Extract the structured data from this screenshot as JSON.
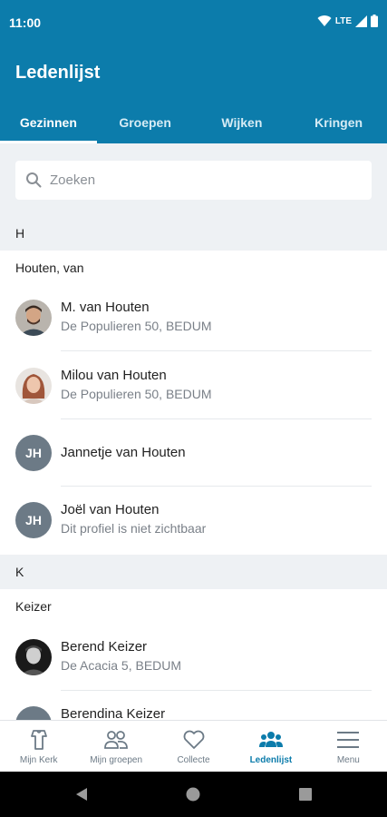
{
  "status_bar": {
    "time": "11:00",
    "network": "LTE"
  },
  "app_bar": {
    "title": "Ledenlijst"
  },
  "tabs": [
    {
      "label": "Gezinnen",
      "active": true
    },
    {
      "label": "Groepen",
      "active": false
    },
    {
      "label": "Wijken",
      "active": false
    },
    {
      "label": "Kringen",
      "active": false
    }
  ],
  "search": {
    "placeholder": "Zoeken",
    "value": ""
  },
  "sections": [
    {
      "letter": "H",
      "family": "Houten, van",
      "members": [
        {
          "name": "M. van Houten",
          "sub": "De Populieren 50, BEDUM",
          "avatar": "photo-man"
        },
        {
          "name": "Milou van Houten",
          "sub": "De Populieren 50, BEDUM",
          "avatar": "photo-woman"
        },
        {
          "name": "Jannetje van Houten",
          "sub": "",
          "avatar": "initials",
          "initials": "JH"
        },
        {
          "name": "Joël van Houten",
          "sub": "Dit profiel is niet zichtbaar",
          "avatar": "initials",
          "initials": "JH"
        }
      ]
    },
    {
      "letter": "K",
      "family": "Keizer",
      "members": [
        {
          "name": "Berend Keizer",
          "sub": "De Acacia 5, BEDUM",
          "avatar": "photo-man-bw"
        },
        {
          "name": "Berendina Keizer",
          "sub": "",
          "avatar": "initials",
          "initials": ""
        }
      ]
    }
  ],
  "bottom_nav": [
    {
      "label": "Mijn Kerk",
      "icon": "church-icon",
      "active": false
    },
    {
      "label": "Mijn groepen",
      "icon": "groups-icon",
      "active": false
    },
    {
      "label": "Collecte",
      "icon": "heart-icon",
      "active": false
    },
    {
      "label": "Ledenlijst",
      "icon": "members-icon",
      "active": true
    },
    {
      "label": "Menu",
      "icon": "menu-icon",
      "active": false
    }
  ],
  "colors": {
    "primary": "#0c7cab",
    "background_light": "#eef1f4",
    "avatar_gray": "#6c7a86"
  }
}
